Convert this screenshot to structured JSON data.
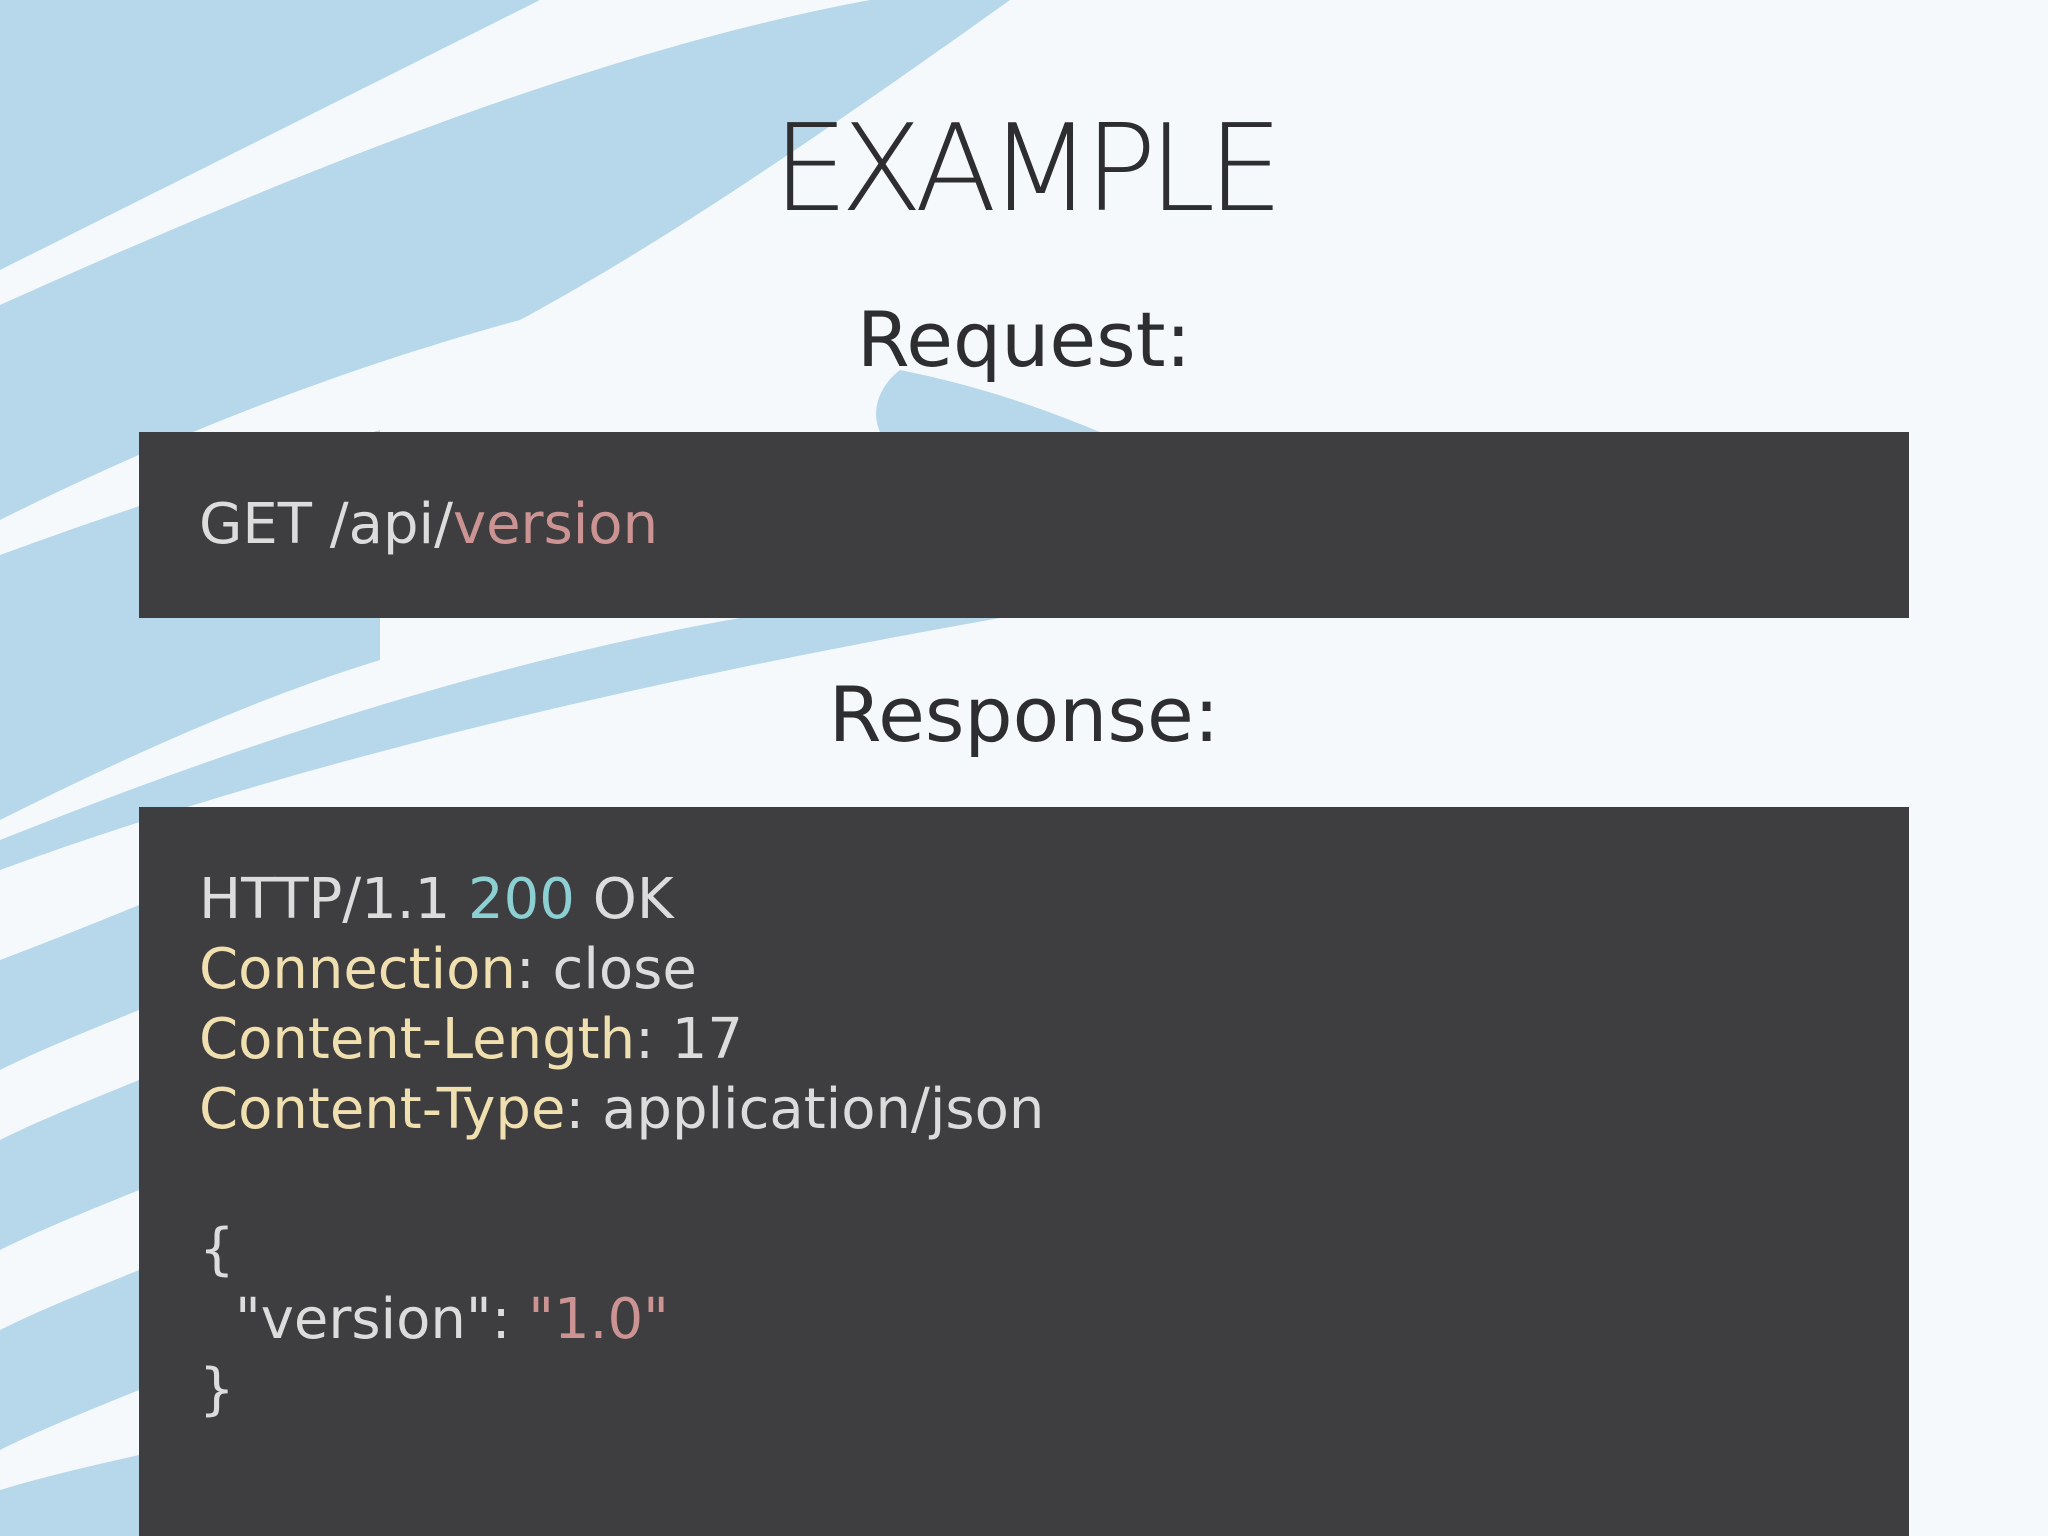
{
  "slide": {
    "title": "EXAMPLE",
    "request_heading": "Request:",
    "response_heading": "Response:"
  },
  "request": {
    "method_path": "GET /api/",
    "resource": "version"
  },
  "response": {
    "status_protocol": "HTTP/1.1 ",
    "status_code": "200",
    "status_text": " OK",
    "headers": [
      {
        "name": "Connection",
        "sep": ": ",
        "value": "close"
      },
      {
        "name": "Content-Length",
        "sep": ": ",
        "value": "17"
      },
      {
        "name": "Content-Type",
        "sep": ": ",
        "value": "application/json"
      }
    ],
    "body_open": "{",
    "body_key": "\"version\": ",
    "body_value": "\"1.0\"",
    "body_close": "}"
  },
  "colors": {
    "background": "#f5f9fc",
    "decor": "#b6d8ea",
    "code_background": "#3e3d40",
    "code_text": "#dcdcdc",
    "string": "#cc9393",
    "number": "#8cd0d3",
    "header_name": "#f0dfaf",
    "title_text": "#2e2e31"
  }
}
